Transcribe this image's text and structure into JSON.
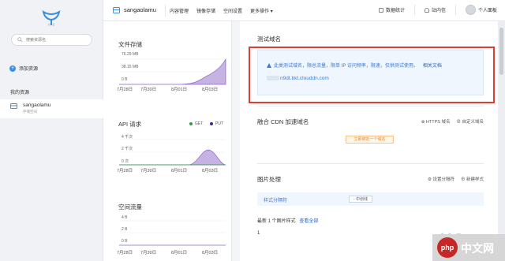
{
  "sidebar": {
    "logo_text": "七牛云",
    "search_placeholder": "搜索资源名",
    "add_resource": "添加资源",
    "my_resources": "我的资源",
    "bucket_name": "sangaolamu",
    "bucket_sub": "存储空间"
  },
  "topbar": {
    "bucket": "sangaolamu",
    "nav": [
      "内容管理",
      "镜像存储",
      "空间设置",
      "更多操作 ▾"
    ],
    "data_stats": "数据统计",
    "messages": "站内信",
    "user": "个人面板"
  },
  "stats": {
    "storage": {
      "title": "文件存储",
      "yticks": [
        "76.29 MB",
        "38.15 MB",
        "0 B"
      ]
    },
    "api": {
      "title": "API 请求",
      "yticks": [
        "4 千次",
        "2 千次",
        "0 次"
      ],
      "legend": [
        "GET",
        "PUT"
      ]
    },
    "traffic": {
      "title": "空间流量",
      "yticks": [
        "4 B",
        "2 B",
        "0 B"
      ]
    },
    "xticks": [
      "7月28日",
      "7月30日",
      "8月01日",
      "8月03日"
    ]
  },
  "chart_data": [
    {
      "type": "area",
      "title": "文件存储",
      "categories": [
        "7月28日",
        "7月30日",
        "8月01日",
        "8月03日"
      ],
      "series": [
        {
          "values": [
            0,
            0,
            0,
            76
          ]
        }
      ],
      "ylim": [
        0,
        76.29
      ]
    },
    {
      "type": "area",
      "title": "API 请求",
      "categories": [
        "7月28日",
        "7月30日",
        "8月01日",
        "8月03日"
      ],
      "series": [
        {
          "name": "GET",
          "values": [
            0,
            0,
            0,
            0
          ]
        },
        {
          "name": "PUT",
          "values": [
            0,
            0,
            0,
            0
          ]
        }
      ]
    },
    {
      "type": "line",
      "title": "空间流量",
      "categories": [
        "7月28日",
        "7月30日",
        "8月01日",
        "8月03日"
      ],
      "series": [
        {
          "values": [
            0,
            0,
            0,
            0
          ]
        }
      ]
    }
  ],
  "main": {
    "test_domain": {
      "title": "测试域名",
      "warning": "此类测试域名，限总流量，限单 IP 访问频率，限速，仅供测试使用。",
      "doc_link": "相关文档",
      "domain": "n9dt.bkt.clouddn.com"
    },
    "cdn": {
      "title": "融合 CDN 加速域名",
      "actions": [
        "⊕ HTTPS 域名",
        "⊕ 自定义域名"
      ],
      "bind_button": "立即绑定一个域名"
    },
    "image": {
      "title": "图片处理",
      "actions": [
        "⚙ 设置分隔符",
        "⊕ 新建样式"
      ],
      "separator_label": "样式分隔符",
      "separator_value": "- 中划线",
      "recent": "最新 1 个图片样式",
      "view_all": "查看全部",
      "row": "1"
    }
  },
  "watermark": {
    "logo": "php",
    "text": "中文网"
  },
  "colors": {
    "accent": "#3a7bd5",
    "chart_fill": "#c6b3e3",
    "chart_line": "#8a63c9",
    "get": "#2e9e44",
    "put": "#3b2a8f",
    "frame": "#e53935"
  }
}
